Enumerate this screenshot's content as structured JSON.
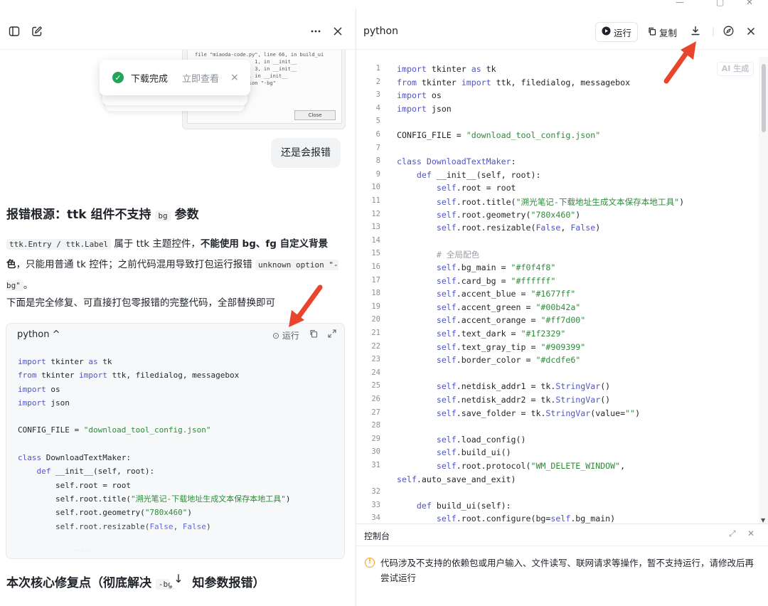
{
  "left": {
    "error_screenshot": {
      "lines": [
        "file \"miaoda-code.py\", line 66, in build_ui",
        "                    1, in __init__",
        "                    3, in __init__",
        "              2805, in __init__",
        "               option \"-bg\""
      ],
      "close_label": "Close"
    },
    "toast": {
      "text": "下载完成",
      "link": "立即查看",
      "close": "×"
    },
    "user_bubble": "还是会报错",
    "heading1": {
      "before": "报错根源：ttk 组件不支持 ",
      "code": "bg",
      "after": " 参数"
    },
    "para1": {
      "code1": "ttk.Entry / ttk.Label",
      "t1": " 属于 ttk 主题控件，",
      "b1": "不能使用 bg、fg 自定义背景色",
      "t2": "，只能用普通 tk 控件；之前代码混用导致打包运行报错 ",
      "code2": "unknown option \"-bg\"",
      "t3": "。"
    },
    "para2": "下面是完全修复、可直接打包零报错的完整代码，全部替换即可",
    "code_card": {
      "lang": "python ^",
      "run_label": "运行"
    },
    "heading2": {
      "before": "本次核心修复点（彻底解决 ",
      "code": "-bg",
      "after": "知参数报错）"
    },
    "scroll_down": "↓"
  },
  "right": {
    "title": "python",
    "run_label": "运行",
    "copy_label": "复制",
    "ai_badge": "AI 生成",
    "console": {
      "title": "控制台",
      "message": "代码涉及不支持的依赖包或用户输入、文件读写、联网请求等操作，暂不支持运行，请修改后再尝试运行"
    }
  },
  "colors": {
    "accent_arrow": "#e8452c",
    "success": "#22a559",
    "warning": "#f0a020",
    "keyword": "#4f55c9",
    "string": "#2e8b3a"
  }
}
